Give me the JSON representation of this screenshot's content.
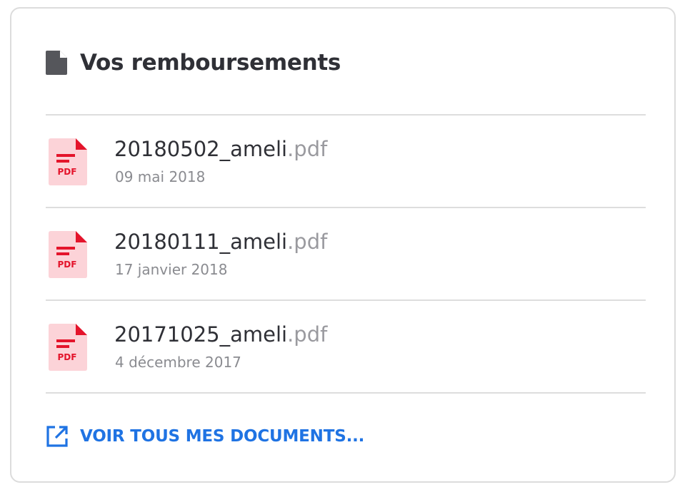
{
  "card": {
    "title": "Vos remboursements",
    "title_icon": "document-icon"
  },
  "documents": [
    {
      "name": "20180502_ameli",
      "extension": ".pdf",
      "date": "09 mai 2018",
      "icon": "pdf-file-icon",
      "icon_label": "PDF"
    },
    {
      "name": "20180111_ameli",
      "extension": ".pdf",
      "date": "17 janvier 2018",
      "icon": "pdf-file-icon",
      "icon_label": "PDF"
    },
    {
      "name": "20171025_ameli",
      "extension": ".pdf",
      "date": "4 décembre 2017",
      "icon": "pdf-file-icon",
      "icon_label": "PDF"
    }
  ],
  "footer": {
    "link_label": "VOIR TOUS MES DOCUMENTS...",
    "link_icon": "external-link-icon"
  },
  "colors": {
    "title_text": "#2f3036",
    "muted_text": "#8a8b90",
    "link_blue": "#1f73e3",
    "pdf_red": "#e4142b",
    "pdf_background": "#fcd3d8",
    "divider": "#dddddd"
  }
}
